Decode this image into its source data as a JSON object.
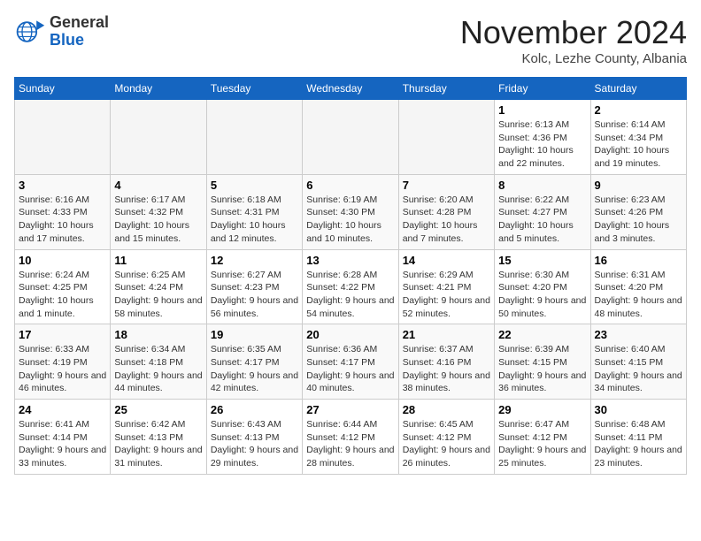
{
  "logo": {
    "general": "General",
    "blue": "Blue"
  },
  "header": {
    "month": "November 2024",
    "location": "Kolc, Lezhe County, Albania"
  },
  "weekdays": [
    "Sunday",
    "Monday",
    "Tuesday",
    "Wednesday",
    "Thursday",
    "Friday",
    "Saturday"
  ],
  "weeks": [
    [
      {
        "day": "",
        "info": ""
      },
      {
        "day": "",
        "info": ""
      },
      {
        "day": "",
        "info": ""
      },
      {
        "day": "",
        "info": ""
      },
      {
        "day": "",
        "info": ""
      },
      {
        "day": "1",
        "info": "Sunrise: 6:13 AM\nSunset: 4:36 PM\nDaylight: 10 hours and 22 minutes."
      },
      {
        "day": "2",
        "info": "Sunrise: 6:14 AM\nSunset: 4:34 PM\nDaylight: 10 hours and 19 minutes."
      }
    ],
    [
      {
        "day": "3",
        "info": "Sunrise: 6:16 AM\nSunset: 4:33 PM\nDaylight: 10 hours and 17 minutes."
      },
      {
        "day": "4",
        "info": "Sunrise: 6:17 AM\nSunset: 4:32 PM\nDaylight: 10 hours and 15 minutes."
      },
      {
        "day": "5",
        "info": "Sunrise: 6:18 AM\nSunset: 4:31 PM\nDaylight: 10 hours and 12 minutes."
      },
      {
        "day": "6",
        "info": "Sunrise: 6:19 AM\nSunset: 4:30 PM\nDaylight: 10 hours and 10 minutes."
      },
      {
        "day": "7",
        "info": "Sunrise: 6:20 AM\nSunset: 4:28 PM\nDaylight: 10 hours and 7 minutes."
      },
      {
        "day": "8",
        "info": "Sunrise: 6:22 AM\nSunset: 4:27 PM\nDaylight: 10 hours and 5 minutes."
      },
      {
        "day": "9",
        "info": "Sunrise: 6:23 AM\nSunset: 4:26 PM\nDaylight: 10 hours and 3 minutes."
      }
    ],
    [
      {
        "day": "10",
        "info": "Sunrise: 6:24 AM\nSunset: 4:25 PM\nDaylight: 10 hours and 1 minute."
      },
      {
        "day": "11",
        "info": "Sunrise: 6:25 AM\nSunset: 4:24 PM\nDaylight: 9 hours and 58 minutes."
      },
      {
        "day": "12",
        "info": "Sunrise: 6:27 AM\nSunset: 4:23 PM\nDaylight: 9 hours and 56 minutes."
      },
      {
        "day": "13",
        "info": "Sunrise: 6:28 AM\nSunset: 4:22 PM\nDaylight: 9 hours and 54 minutes."
      },
      {
        "day": "14",
        "info": "Sunrise: 6:29 AM\nSunset: 4:21 PM\nDaylight: 9 hours and 52 minutes."
      },
      {
        "day": "15",
        "info": "Sunrise: 6:30 AM\nSunset: 4:20 PM\nDaylight: 9 hours and 50 minutes."
      },
      {
        "day": "16",
        "info": "Sunrise: 6:31 AM\nSunset: 4:20 PM\nDaylight: 9 hours and 48 minutes."
      }
    ],
    [
      {
        "day": "17",
        "info": "Sunrise: 6:33 AM\nSunset: 4:19 PM\nDaylight: 9 hours and 46 minutes."
      },
      {
        "day": "18",
        "info": "Sunrise: 6:34 AM\nSunset: 4:18 PM\nDaylight: 9 hours and 44 minutes."
      },
      {
        "day": "19",
        "info": "Sunrise: 6:35 AM\nSunset: 4:17 PM\nDaylight: 9 hours and 42 minutes."
      },
      {
        "day": "20",
        "info": "Sunrise: 6:36 AM\nSunset: 4:17 PM\nDaylight: 9 hours and 40 minutes."
      },
      {
        "day": "21",
        "info": "Sunrise: 6:37 AM\nSunset: 4:16 PM\nDaylight: 9 hours and 38 minutes."
      },
      {
        "day": "22",
        "info": "Sunrise: 6:39 AM\nSunset: 4:15 PM\nDaylight: 9 hours and 36 minutes."
      },
      {
        "day": "23",
        "info": "Sunrise: 6:40 AM\nSunset: 4:15 PM\nDaylight: 9 hours and 34 minutes."
      }
    ],
    [
      {
        "day": "24",
        "info": "Sunrise: 6:41 AM\nSunset: 4:14 PM\nDaylight: 9 hours and 33 minutes."
      },
      {
        "day": "25",
        "info": "Sunrise: 6:42 AM\nSunset: 4:13 PM\nDaylight: 9 hours and 31 minutes."
      },
      {
        "day": "26",
        "info": "Sunrise: 6:43 AM\nSunset: 4:13 PM\nDaylight: 9 hours and 29 minutes."
      },
      {
        "day": "27",
        "info": "Sunrise: 6:44 AM\nSunset: 4:12 PM\nDaylight: 9 hours and 28 minutes."
      },
      {
        "day": "28",
        "info": "Sunrise: 6:45 AM\nSunset: 4:12 PM\nDaylight: 9 hours and 26 minutes."
      },
      {
        "day": "29",
        "info": "Sunrise: 6:47 AM\nSunset: 4:12 PM\nDaylight: 9 hours and 25 minutes."
      },
      {
        "day": "30",
        "info": "Sunrise: 6:48 AM\nSunset: 4:11 PM\nDaylight: 9 hours and 23 minutes."
      }
    ]
  ]
}
